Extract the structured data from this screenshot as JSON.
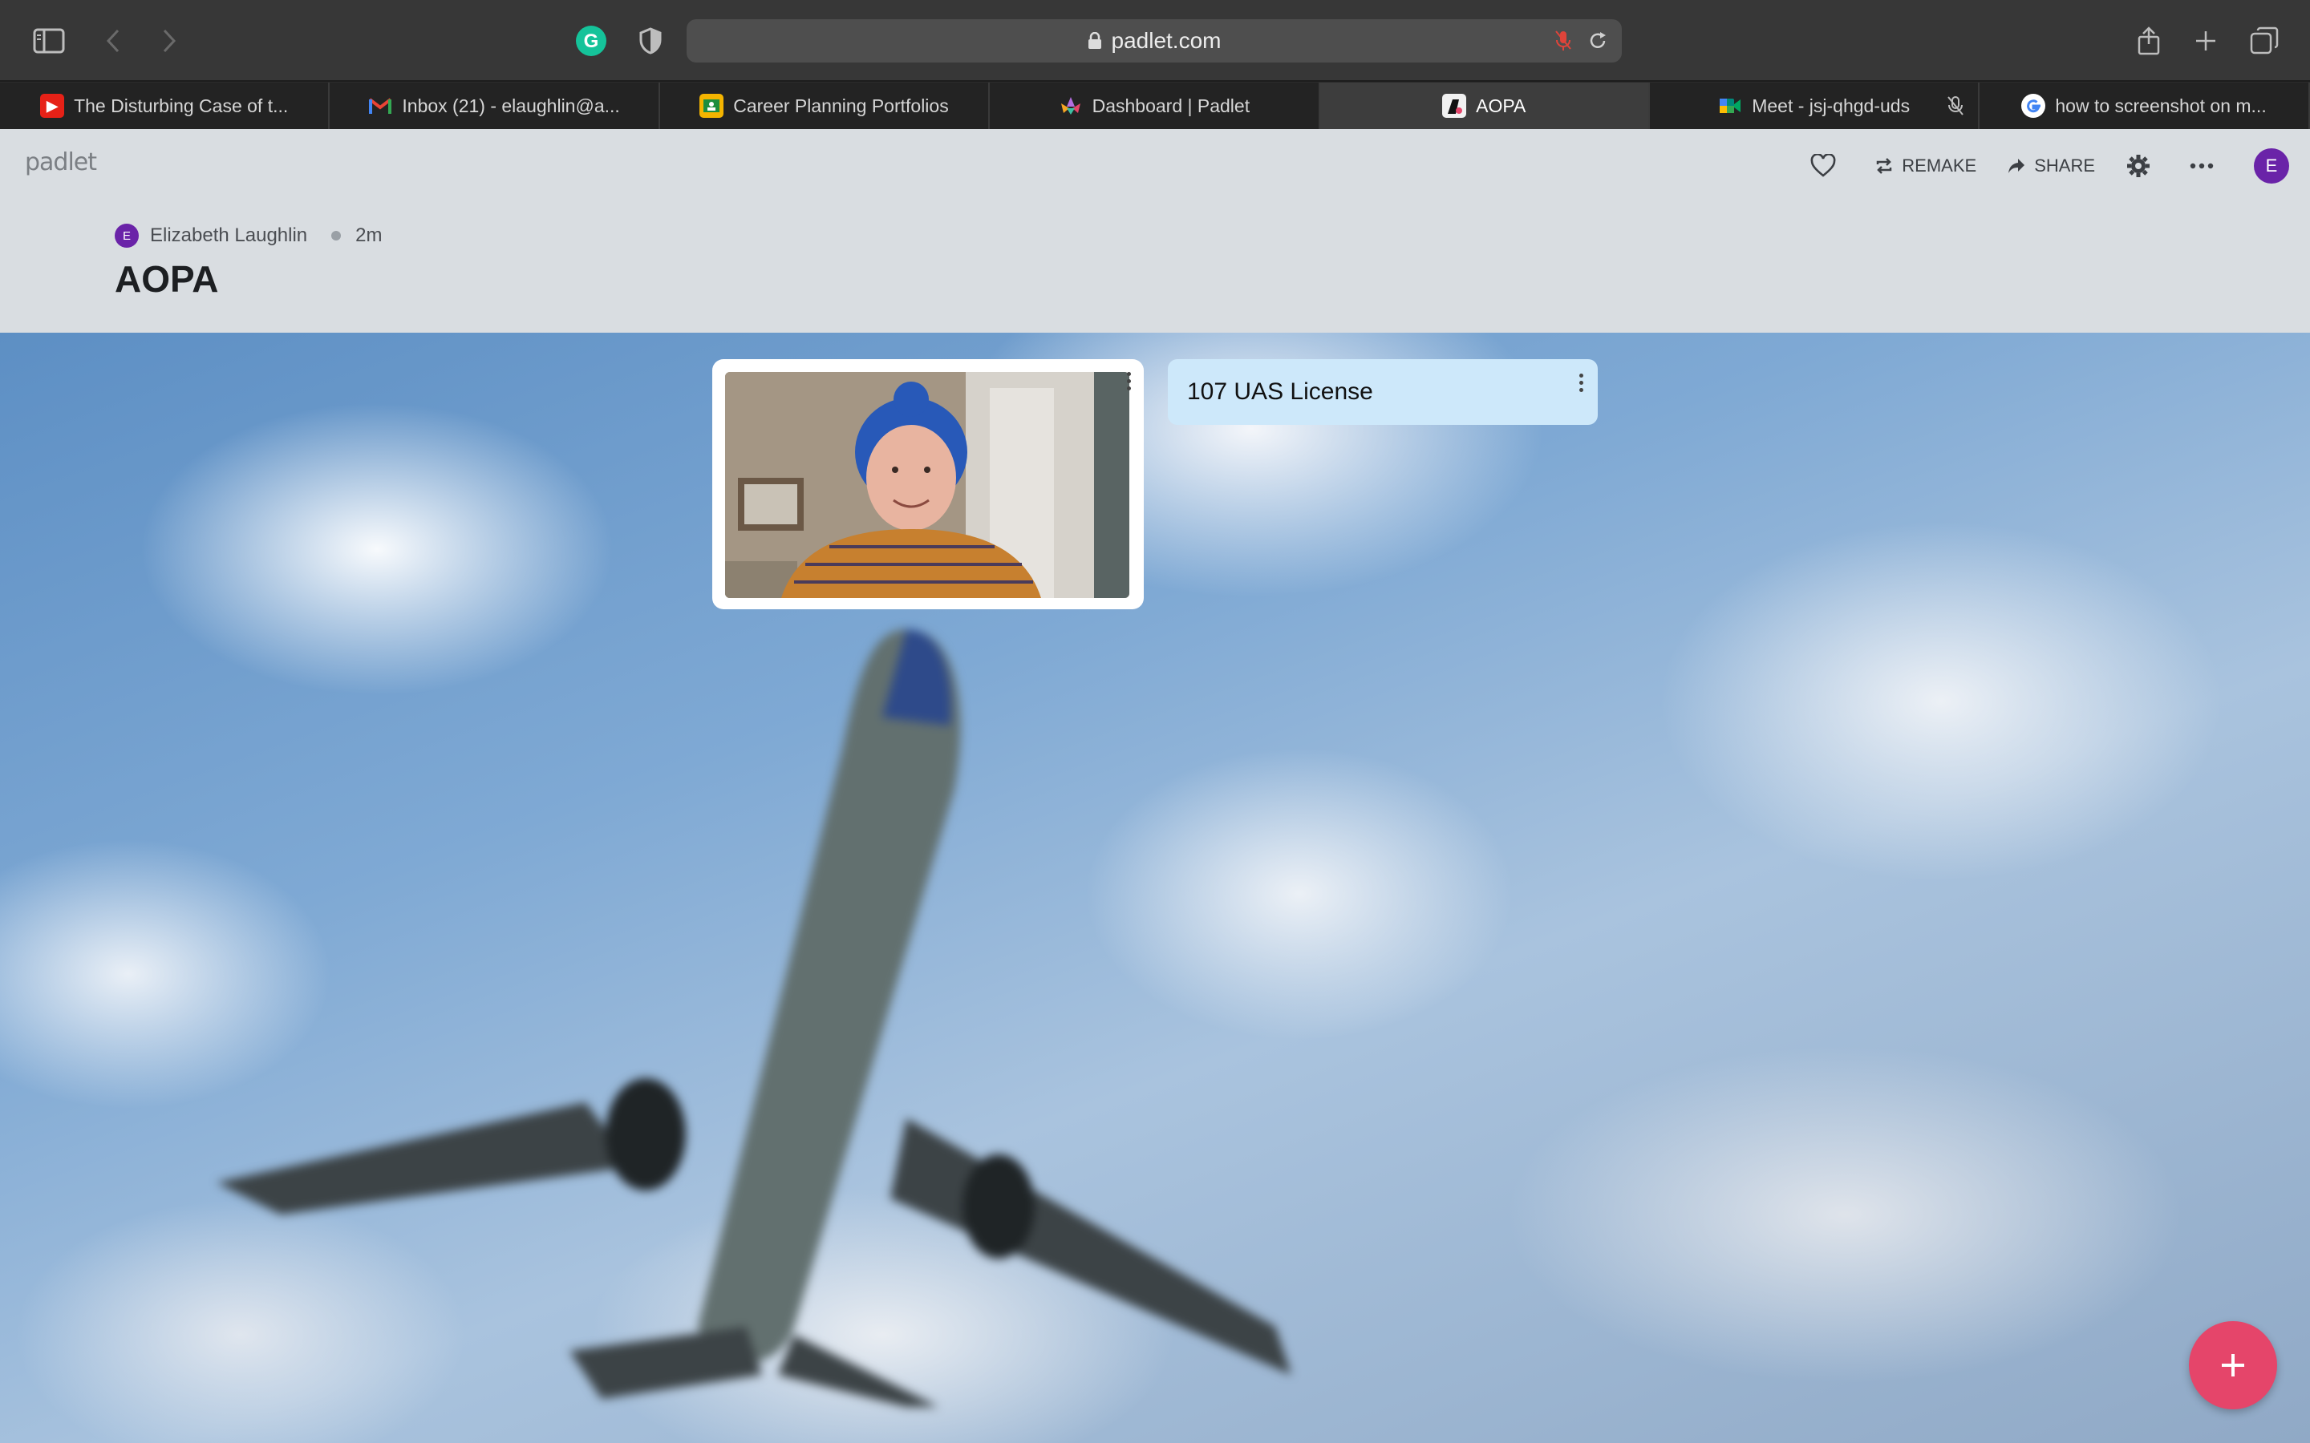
{
  "browser": {
    "url": "padlet.com",
    "tabs": [
      {
        "label": "The Disturbing Case of t...",
        "icon": "youtube-icon",
        "color": "#e62117"
      },
      {
        "label": "Inbox (21) - elaughlin@a...",
        "icon": "gmail-icon",
        "color": "#ea4335"
      },
      {
        "label": "Career Planning Portfolios",
        "icon": "google-classroom-icon",
        "color": "#f4b400"
      },
      {
        "label": "Dashboard | Padlet",
        "icon": "padlet-icon",
        "color": "#b46ee0"
      },
      {
        "label": "AOPA",
        "icon": "padlet-board-icon",
        "color": "#111111",
        "active": true
      },
      {
        "label": "Meet - jsj-qhgd-uds",
        "icon": "google-meet-icon",
        "color": "#00897b"
      },
      {
        "label": "how to screenshot on m...",
        "icon": "google-icon",
        "color": "#4285f4"
      }
    ]
  },
  "header": {
    "brand": "padlet",
    "actions": {
      "remake": "REMAKE",
      "share": "SHARE"
    },
    "user_initial": "E"
  },
  "board": {
    "author_initial": "E",
    "author": "Elizabeth Laughlin",
    "time": "2m",
    "title": "AOPA"
  },
  "posts": [
    {
      "type": "image",
      "content": "webcam-photo"
    },
    {
      "type": "text",
      "title": "107 UAS License"
    }
  ],
  "colors": {
    "accent": "#e5456a",
    "avatar": "#6a23a8",
    "text_post_bg": "#cde8fa"
  }
}
